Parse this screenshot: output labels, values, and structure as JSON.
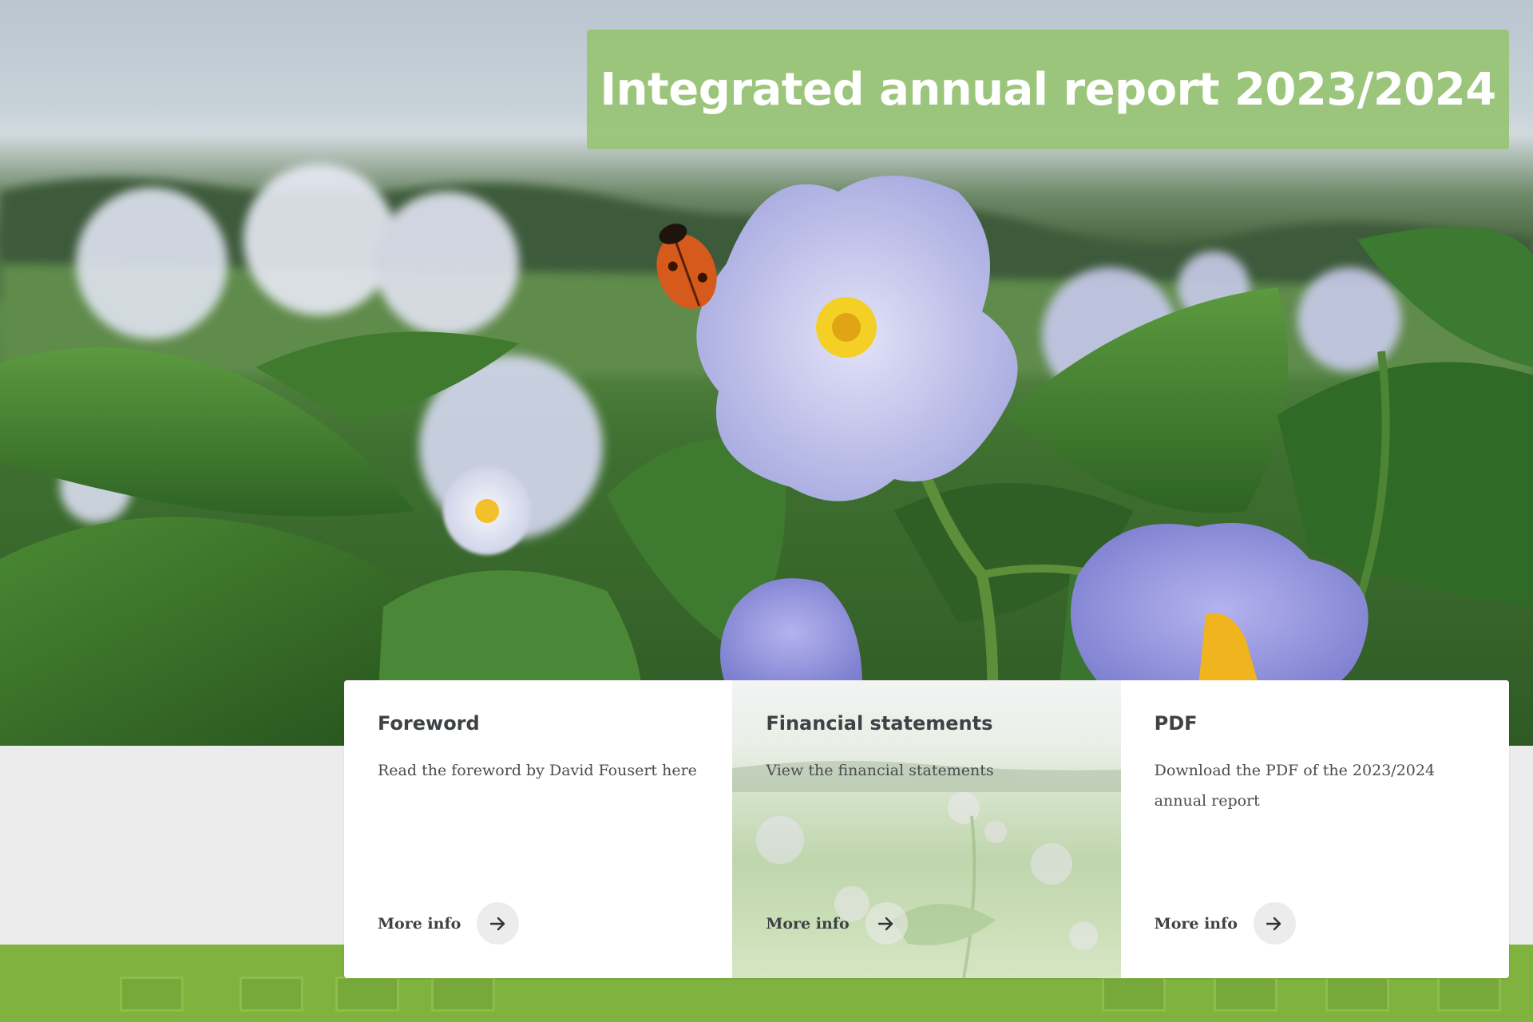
{
  "hero": {
    "title": "Integrated annual report 2023/2024"
  },
  "cards": [
    {
      "title": "Foreword",
      "description": "Read the foreword by David Fousert here",
      "link_label": "More info"
    },
    {
      "title": "Financial statements",
      "description": "View the financial statements",
      "link_label": "More info"
    },
    {
      "title": "PDF",
      "description": "Download the PDF of the 2023/2024 annual report",
      "link_label": "More info"
    }
  ],
  "colors": {
    "title_banner": "#98c474",
    "footer_band": "#7fb23f",
    "card_title": "#3e4245",
    "arrow_button": "#ececec"
  },
  "icons": {
    "link_arrow": "arrow-right-icon"
  }
}
